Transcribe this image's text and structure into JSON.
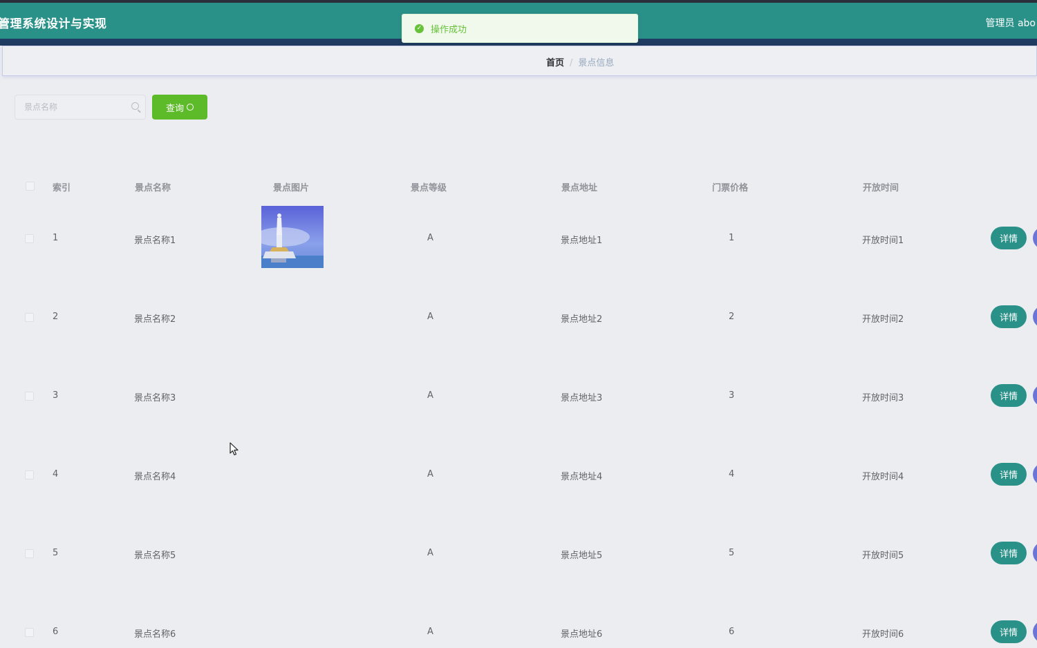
{
  "header": {
    "title": "管理系统设计与实现",
    "user_label": "管理员 abo"
  },
  "toast": {
    "message": "操作成功"
  },
  "breadcrumb": {
    "home": "首页",
    "separator": "/",
    "current": "景点信息"
  },
  "search": {
    "placeholder": "景点名称",
    "value": "",
    "button_label": "查询"
  },
  "table": {
    "columns": [
      "索引",
      "景点名称",
      "景点图片",
      "景点等级",
      "景点地址",
      "门票价格",
      "开放时间"
    ],
    "rows": [
      {
        "index": "1",
        "name": "景点名称1",
        "level": "A",
        "address": "景点地址1",
        "price": "1",
        "open_time": "开放时间1",
        "detail_label": "详情"
      },
      {
        "index": "2",
        "name": "景点名称2",
        "level": "A",
        "address": "景点地址2",
        "price": "2",
        "open_time": "开放时间2",
        "detail_label": "详情"
      },
      {
        "index": "3",
        "name": "景点名称3",
        "level": "A",
        "address": "景点地址3",
        "price": "3",
        "open_time": "开放时间3",
        "detail_label": "详情"
      },
      {
        "index": "4",
        "name": "景点名称4",
        "level": "A",
        "address": "景点地址4",
        "price": "4",
        "open_time": "开放时间4",
        "detail_label": "详情"
      },
      {
        "index": "5",
        "name": "景点名称5",
        "level": "A",
        "address": "景点地址5",
        "price": "5",
        "open_time": "开放时间5",
        "detail_label": "详情"
      },
      {
        "index": "6",
        "name": "景点名称6",
        "level": "A",
        "address": "景点地址6",
        "price": "6",
        "open_time": "开放时间6",
        "detail_label": "详情"
      }
    ]
  },
  "colors": {
    "header": "#2a9189",
    "query_button": "#5dbb2a",
    "detail_button": "#2a9189",
    "success": "#67c23a"
  }
}
